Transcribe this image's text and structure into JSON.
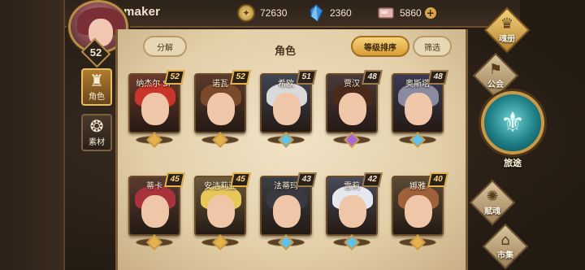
{
  "player": {
    "name": "Clownmaker",
    "level": "52"
  },
  "resources": {
    "gold": {
      "icon": "gold-coin-icon",
      "value": "72630"
    },
    "crystal": {
      "icon": "blue-crystal-icon",
      "value": "2360"
    },
    "stone": {
      "icon": "pink-stone-icon",
      "value": "5860",
      "plus": "+"
    }
  },
  "left_nav": [
    {
      "icon": "helmet-icon",
      "label": "角色",
      "selected": true
    },
    {
      "icon": "beast-head-icon",
      "label": "素材",
      "selected": false
    }
  ],
  "panel": {
    "title": "角色",
    "decompose_label": "分解",
    "sort_label": "等级排序",
    "filter_label": "筛选"
  },
  "heroes": [
    {
      "name": "纳杰尔 SP",
      "level": "52",
      "rarity": "gold",
      "hair": "#c8362b"
    },
    {
      "name": "诺瓦",
      "level": "52",
      "rarity": "gold",
      "hair": "#7a4a2a"
    },
    {
      "name": "希欧",
      "level": "51",
      "rarity": "blue",
      "hair": "#d9d9d9"
    },
    {
      "name": "贾汉",
      "level": "48",
      "rarity": "purple",
      "hair": "#4a2a1a"
    },
    {
      "name": "奥斯塔",
      "level": "48",
      "rarity": "blue",
      "hair": "#8a8aa0"
    },
    {
      "name": "蒂卡",
      "level": "45",
      "rarity": "gold",
      "hair": "#a8333a"
    },
    {
      "name": "安洁莉亚",
      "level": "45",
      "rarity": "gold",
      "hair": "#e8c75a"
    },
    {
      "name": "法蒂玛",
      "level": "43",
      "rarity": "blue",
      "hair": "#3a3a40"
    },
    {
      "name": "雪莉",
      "level": "42",
      "rarity": "blue",
      "hair": "#e6e8ef"
    },
    {
      "name": "娜雅",
      "level": "40",
      "rarity": "gold",
      "hair": "#a0603a"
    }
  ],
  "right_menu": {
    "summon": {
      "icon": "winged-crest-icon",
      "label": "魂册"
    },
    "guild": {
      "icon": "guild-banner-icon",
      "label": "公会"
    },
    "journey": {
      "icon": "trident-emblem-icon",
      "label": "旅途"
    },
    "soul": {
      "icon": "flame-icon",
      "label": "赋魂"
    },
    "market": {
      "icon": "market-stall-icon",
      "label": "市集"
    }
  },
  "colors": {
    "gold": "#e3b24d",
    "blue": "#5fc2e8",
    "purple": "#a86ad8",
    "panel": "#efe0c2"
  }
}
